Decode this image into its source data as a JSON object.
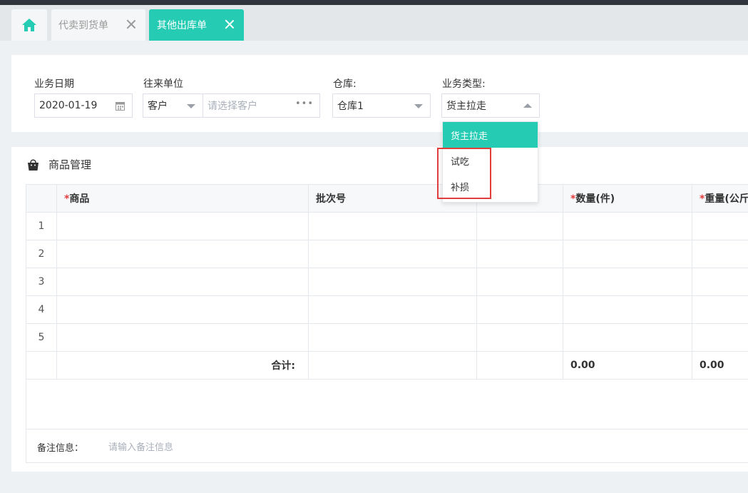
{
  "tabs": [
    {
      "label": "",
      "icon": "home-icon",
      "active": false
    },
    {
      "label": "代卖到货单",
      "active": false
    },
    {
      "label": "其他出库单",
      "active": true
    }
  ],
  "form": {
    "date_label": "业务日期",
    "date_value": "2020-01-19",
    "partner_label": "往来单位",
    "partner_type": "客户",
    "partner_placeholder": "请选择客户",
    "warehouse_label": "仓库:",
    "warehouse_value": "仓库1",
    "biz_type_label": "业务类型:",
    "biz_type_value": "货主拉走"
  },
  "biz_type_options": [
    "货主拉走",
    "试吃",
    "补损"
  ],
  "goods": {
    "title": "商品管理",
    "columns": [
      "商品",
      "批次号",
      "",
      "数量(件)",
      "重量(公斤)"
    ],
    "required_marker": "*",
    "rows": [
      "1",
      "2",
      "3",
      "4",
      "5"
    ],
    "sum_label": "合计:",
    "sum_qty": "0.00",
    "sum_weight": "0.00",
    "remark_label": "备注信息：",
    "remark_placeholder": "请输入备注信息"
  },
  "colors": {
    "accent": "#25ccb3",
    "highlight": "#e23d3d"
  }
}
